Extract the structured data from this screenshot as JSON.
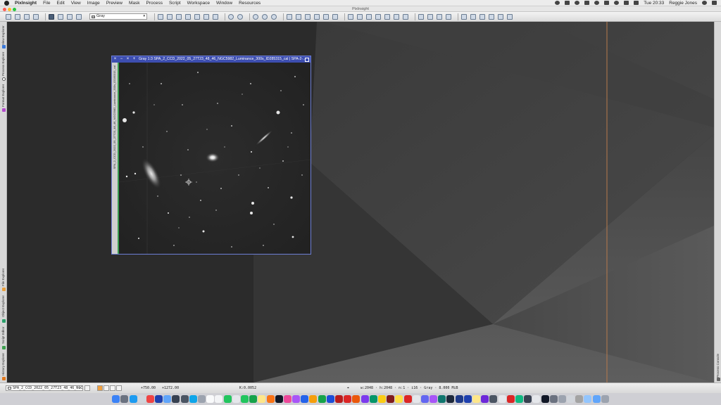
{
  "menubar": {
    "app": "PixInsight",
    "items": [
      "File",
      "Edit",
      "View",
      "Image",
      "Preview",
      "Mask",
      "Process",
      "Script",
      "Workspace",
      "Window",
      "Resources"
    ],
    "clock": "Tue 20:33",
    "user": "Reggie Jones"
  },
  "window": {
    "title": "PixInsight"
  },
  "toolbar": {
    "colorspace_select": "Gray"
  },
  "left_tabs": [
    "View Explorer",
    "Process Explorer",
    "Format Explorer",
    "File Explorer",
    "Object Explorer",
    "Script Editor",
    "History Explorer"
  ],
  "right_tabs": [
    "Process Console"
  ],
  "image_window": {
    "title": "Gray 1:3 SPA_2_CCD_2022_05_27T23_48_46_NGC5982_Luminance_300s_ID285315_cal | SPA-2-...",
    "side_label": "SPA_2_CCD_2022_05_27T23_48_46_NGC5982_Luminance_300s_ID285315_cal"
  },
  "statusbar": {
    "view_select": "SPA_2_CCD_2022_05_27T23_48_46_NGC",
    "cursor_x": "+750.00",
    "cursor_y": "+1272.00",
    "value": "K:0.0052",
    "info": "w:2048 · h:2048 · n:1 · i16 · Gray · 8.000 MiB"
  },
  "colors": {
    "title_active": "#3d4eb0",
    "accent_line": "#b87a4c",
    "sidebar_green": "#3a9c50"
  }
}
